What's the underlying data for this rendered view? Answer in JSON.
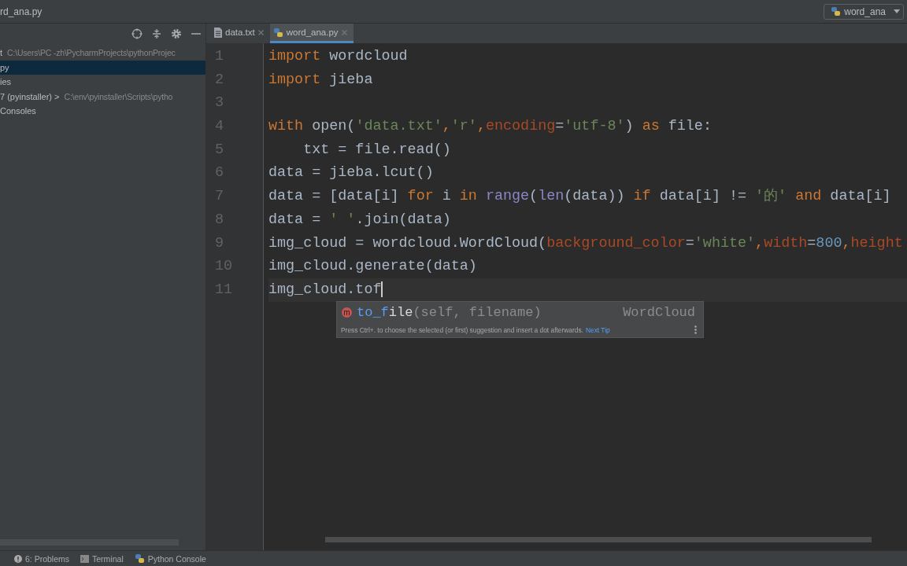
{
  "title_bar": {
    "file": "rd_ana.py",
    "run_config": "word_ana"
  },
  "project_panel": {
    "items": [
      {
        "label": "t",
        "path": "C:\\Users\\PC -zh\\PycharmProjects\\pythonProjec",
        "selected": false
      },
      {
        "label": "py",
        "selected": true
      },
      {
        "label": "ies",
        "selected": false
      },
      {
        "label": "7 (pyinstaller) >",
        "path": "C:\\env\\pyinstaller\\Scripts\\pytho",
        "selected": false
      },
      {
        "label": "Consoles",
        "selected": false
      }
    ]
  },
  "tabs": [
    {
      "label": "data.txt",
      "kind": "text",
      "selected": false
    },
    {
      "label": "word_ana.py",
      "kind": "python",
      "selected": true
    }
  ],
  "editor": {
    "lines": [
      {
        "number": "1",
        "current": false,
        "tokens": [
          {
            "text": "import",
            "kind": "kw"
          },
          {
            "text": " wordcloud",
            "kind": "id"
          }
        ]
      },
      {
        "number": "2",
        "current": false,
        "tokens": [
          {
            "text": "import",
            "kind": "kw"
          },
          {
            "text": " jieba",
            "kind": "id"
          }
        ]
      },
      {
        "number": "3",
        "current": false
      },
      {
        "number": "4",
        "current": false,
        "tokens": [
          {
            "text": "with",
            "kind": "kw"
          },
          {
            "text": " open(",
            "kind": "id"
          },
          {
            "text": "'data.txt'",
            "kind": "str"
          },
          {
            "text": ",",
            "kind": "kw"
          },
          {
            "text": "'r'",
            "kind": "str"
          },
          {
            "text": ",",
            "kind": "kw"
          },
          {
            "text": "encoding",
            "kind": "param"
          },
          {
            "text": "=",
            "kind": "id"
          },
          {
            "text": "'utf-8'",
            "kind": "str"
          },
          {
            "text": ") ",
            "kind": "id"
          },
          {
            "text": "as",
            "kind": "kw"
          },
          {
            "text": " file:",
            "kind": "id"
          }
        ]
      },
      {
        "number": "5",
        "current": false,
        "tokens": [
          {
            "text": "    txt = file.read()",
            "kind": "id"
          }
        ]
      },
      {
        "number": "6",
        "current": false,
        "tokens": [
          {
            "text": "data = jieba.lcut()",
            "kind": "id"
          }
        ]
      },
      {
        "number": "7",
        "current": false,
        "tokens": [
          {
            "text": "data = [data[i] ",
            "kind": "id"
          },
          {
            "text": "for",
            "kind": "kw"
          },
          {
            "text": " i ",
            "kind": "id"
          },
          {
            "text": "in",
            "kind": "kw"
          },
          {
            "text": " range",
            "kind": "builtin"
          },
          {
            "text": "(",
            "kind": "id"
          },
          {
            "text": "len",
            "kind": "builtin"
          },
          {
            "text": "(data)) ",
            "kind": "id"
          },
          {
            "text": "if",
            "kind": "kw"
          },
          {
            "text": " data[i] != ",
            "kind": "id"
          },
          {
            "text": "'的'",
            "kind": "str"
          },
          {
            "text": " and",
            "kind": "kw"
          },
          {
            "text": " data[i]",
            "kind": "id"
          }
        ]
      },
      {
        "number": "8",
        "current": false,
        "tokens": [
          {
            "text": "data = ",
            "kind": "id"
          },
          {
            "text": "' '",
            "kind": "str"
          },
          {
            "text": ".join(data)",
            "kind": "id"
          }
        ]
      },
      {
        "number": "9",
        "current": false,
        "tokens": [
          {
            "text": "img_cloud = wordcloud.WordCloud(",
            "kind": "id"
          },
          {
            "text": "background_color",
            "kind": "param"
          },
          {
            "text": "=",
            "kind": "id"
          },
          {
            "text": "'white'",
            "kind": "str"
          },
          {
            "text": ",",
            "kind": "kw"
          },
          {
            "text": "width",
            "kind": "param"
          },
          {
            "text": "=",
            "kind": "id"
          },
          {
            "text": "800",
            "kind": "num"
          },
          {
            "text": ",",
            "kind": "kw"
          },
          {
            "text": "height",
            "kind": "param"
          }
        ]
      },
      {
        "number": "10",
        "current": false,
        "tokens": [
          {
            "text": "img_cloud.generate(data)",
            "kind": "id"
          }
        ]
      },
      {
        "number": "11",
        "current": true,
        "tokens": [
          {
            "text": "img_cloud.tof",
            "kind": "id"
          }
        ]
      }
    ]
  },
  "completion": {
    "badge": "m",
    "parts": [
      {
        "text": "to_f",
        "kind": "match"
      },
      {
        "text": "ile",
        "kind": "name"
      },
      {
        "text": "(self, filename)",
        "kind": "params"
      }
    ],
    "type": "WordCloud",
    "hint": "Press Ctrl+. to choose the selected (or first) suggestion and insert a dot afterwards.",
    "link": "Next Tip"
  },
  "tool_windows": [
    {
      "label": "6: Problems",
      "kind": "problems"
    },
    {
      "label": "Terminal",
      "kind": "terminal"
    },
    {
      "label": "Python Console",
      "kind": "python"
    }
  ]
}
